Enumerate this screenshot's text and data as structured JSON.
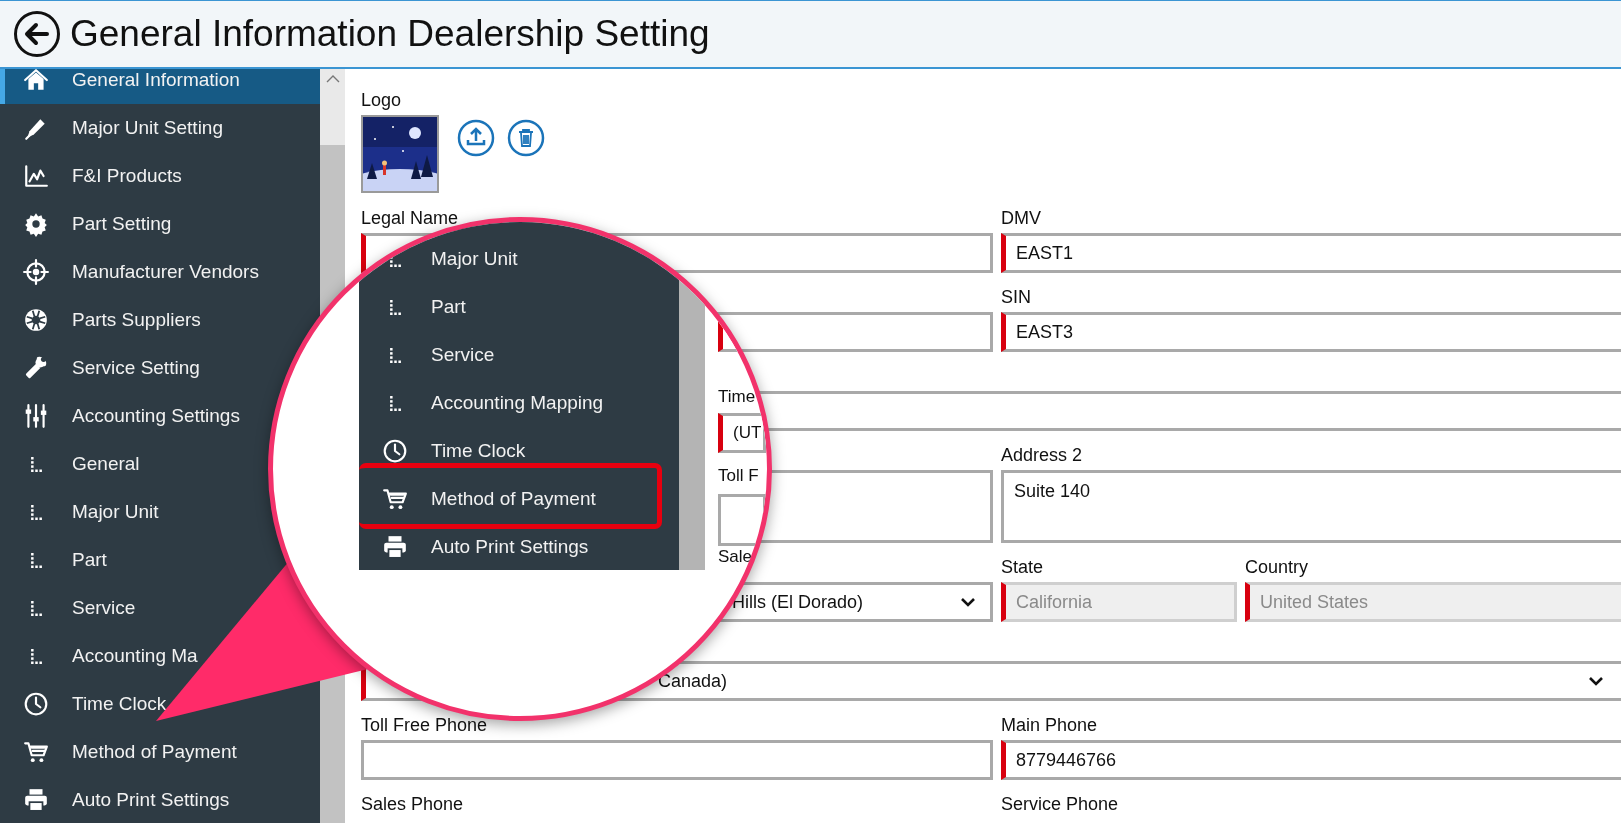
{
  "header": {
    "title": "General Information Dealership Setting"
  },
  "sidebar": {
    "items": [
      {
        "label": "General Information",
        "selected": true
      },
      {
        "label": "Major Unit Setting",
        "selected": false
      },
      {
        "label": "F&I Products",
        "selected": false
      },
      {
        "label": "Part Setting",
        "selected": false
      },
      {
        "label": "Manufacturer Vendors",
        "selected": false
      },
      {
        "label": "Parts Suppliers",
        "selected": false
      },
      {
        "label": "Service Setting",
        "selected": false
      },
      {
        "label": "Accounting Settings",
        "selected": false,
        "children": [
          {
            "label": "General",
            "selected": false
          },
          {
            "label": "Major Unit",
            "selected": false
          },
          {
            "label": "Part",
            "selected": false
          },
          {
            "label": "Service",
            "selected": false
          },
          {
            "label": "Accounting Ma",
            "selected": false
          }
        ]
      },
      {
        "label": "Time Clock",
        "selected": false
      },
      {
        "label": "Method of Payment",
        "selected": false
      },
      {
        "label": "Auto Print Settings",
        "selected": false
      }
    ]
  },
  "form": {
    "logo_label": "Logo",
    "rows": [
      {
        "fields": [
          {
            "kind": "text",
            "label": "Legal Name",
            "required": true
          },
          {
            "kind": "text",
            "label": "DMV",
            "value": "EAST1",
            "required": true
          }
        ]
      },
      {
        "fields": [
          {
            "kind": "text",
            "required": false
          },
          {
            "kind": "text",
            "label": "SIN",
            "value": "EAST3",
            "required": true
          }
        ]
      },
      {
        "fields": [
          {
            "kind": "text",
            "required": false
          }
        ]
      },
      {
        "fields": [
          {
            "kind": "textarea",
            "required": false
          },
          {
            "kind": "textarea",
            "label": "Address 2",
            "value": "Suite 140",
            "required": false
          }
        ]
      },
      {
        "fields": [
          {
            "kind": "select",
            "value": "Hills (El Dorado)",
            "required": false
          },
          {
            "kind": "text",
            "label": "State",
            "value": "California",
            "required": true,
            "disabled": true
          },
          {
            "kind": "text",
            "label": "Country",
            "value": "United States",
            "required": true,
            "disabled": true
          }
        ]
      },
      {
        "fields": [
          {
            "kind": "select",
            "value": "Canada)",
            "required": true
          }
        ]
      },
      {
        "fields": [
          {
            "kind": "text",
            "label": "Toll Free Phone",
            "required": false
          },
          {
            "kind": "text",
            "label": "Main Phone",
            "value": "8779446766",
            "required": true
          }
        ]
      },
      {
        "fields": [
          {
            "kind": "label",
            "label": "Sales Phone"
          },
          {
            "kind": "label",
            "label": "Service Phone"
          }
        ]
      }
    ]
  },
  "magnifier": {
    "items": [
      {
        "kind": "sub",
        "label": "Major Unit",
        "highlighted": false
      },
      {
        "kind": "sub",
        "label": "Part",
        "highlighted": false
      },
      {
        "kind": "sub",
        "label": "Service",
        "highlighted": false
      },
      {
        "kind": "sub",
        "label": "Accounting Mapping",
        "highlighted": false
      },
      {
        "kind": "main",
        "label": "Time Clock",
        "highlighted": false
      },
      {
        "kind": "main",
        "label": "Method of Payment",
        "highlighted": true
      },
      {
        "kind": "main",
        "label": "Auto Print Settings",
        "highlighted": false
      }
    ],
    "fragments": [
      {
        "kind": "field",
        "required": true
      },
      {
        "kind": "label",
        "text": "Time"
      },
      {
        "kind": "field",
        "value": "(UT",
        "required": true
      },
      {
        "kind": "label",
        "text": "Toll F"
      },
      {
        "kind": "textarea",
        "required": false
      },
      {
        "kind": "label",
        "text": "Sale"
      }
    ]
  }
}
